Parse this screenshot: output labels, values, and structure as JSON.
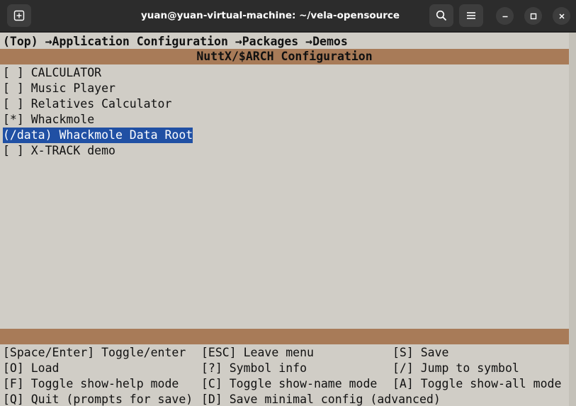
{
  "window": {
    "title": "yuan@yuan-virtual-machine: ~/vela-opensource"
  },
  "menuconfig": {
    "breadcrumb": "(Top) →Application Configuration →Packages →Demos",
    "config_title": "NuttX/$ARCH Configuration",
    "items": [
      {
        "text": "[ ] CALCULATOR"
      },
      {
        "text": "[ ] Music Player"
      },
      {
        "text": "[ ] Relatives Calculator"
      },
      {
        "text": "[*] Whackmole"
      },
      {
        "text": "(/data) Whackmole Data Root"
      },
      {
        "text": "[ ] X-TRACK demo"
      }
    ],
    "help_rows": [
      [
        "[Space/Enter] Toggle/enter",
        "[ESC] Leave menu",
        "[S] Save"
      ],
      [
        "[O] Load",
        "[?] Symbol info",
        "[/] Jump to symbol"
      ],
      [
        "[F] Toggle show-help mode",
        "[C] Toggle show-name mode",
        "[A] Toggle show-all mode"
      ],
      [
        "[Q] Quit (prompts for save)",
        "[D] Save minimal config (advanced)",
        ""
      ]
    ]
  },
  "colors": {
    "terminal_bg": "#d0cdc6",
    "bar": "#a87b58",
    "selection": "#2050a4",
    "titlebar": "#2c2c2c"
  }
}
